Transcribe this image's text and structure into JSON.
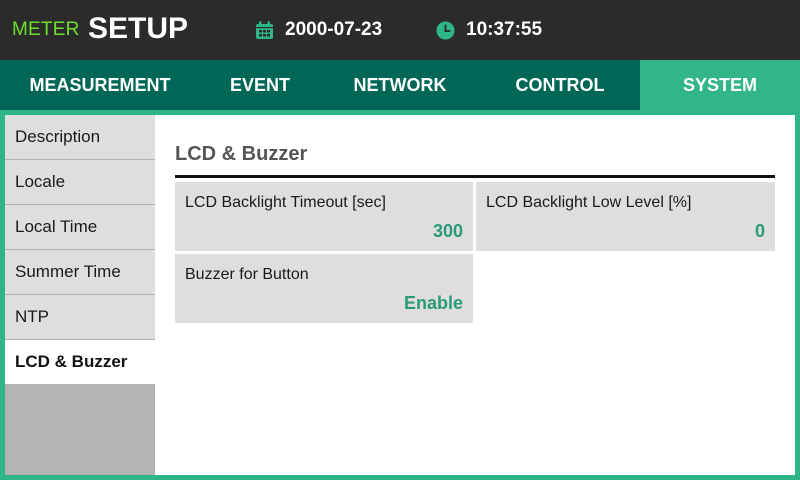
{
  "header": {
    "brand_meter": "METER",
    "brand_setup": "SETUP",
    "date": "2000-07-23",
    "time": "10:37:55",
    "date_icon": "calendar-icon",
    "time_icon": "clock-icon"
  },
  "tabs": [
    {
      "label": "MEASUREMENT",
      "active": false
    },
    {
      "label": "EVENT",
      "active": false
    },
    {
      "label": "NETWORK",
      "active": false
    },
    {
      "label": "CONTROL",
      "active": false
    },
    {
      "label": "SYSTEM",
      "active": true
    }
  ],
  "sidebar": {
    "items": [
      {
        "label": "Description",
        "active": false
      },
      {
        "label": "Locale",
        "active": false
      },
      {
        "label": "Local Time",
        "active": false
      },
      {
        "label": "Summer Time",
        "active": false
      },
      {
        "label": "NTP",
        "active": false
      },
      {
        "label": "LCD & Buzzer",
        "active": true
      }
    ]
  },
  "main": {
    "title": "LCD & Buzzer",
    "settings": [
      {
        "label": "LCD Backlight Timeout [sec]",
        "value": "300"
      },
      {
        "label": "LCD Backlight Low Level [%]",
        "value": "0"
      },
      {
        "label": "Buzzer for Button",
        "value": "Enable"
      }
    ]
  },
  "colors": {
    "header_bg": "#2b2b2b",
    "brand_meter": "#6ee02a",
    "tab_bar": "#006655",
    "tab_active": "#33b58b",
    "frame": "#2fb58a",
    "value_text": "#2a9a7a",
    "card_bg": "#dedede"
  }
}
